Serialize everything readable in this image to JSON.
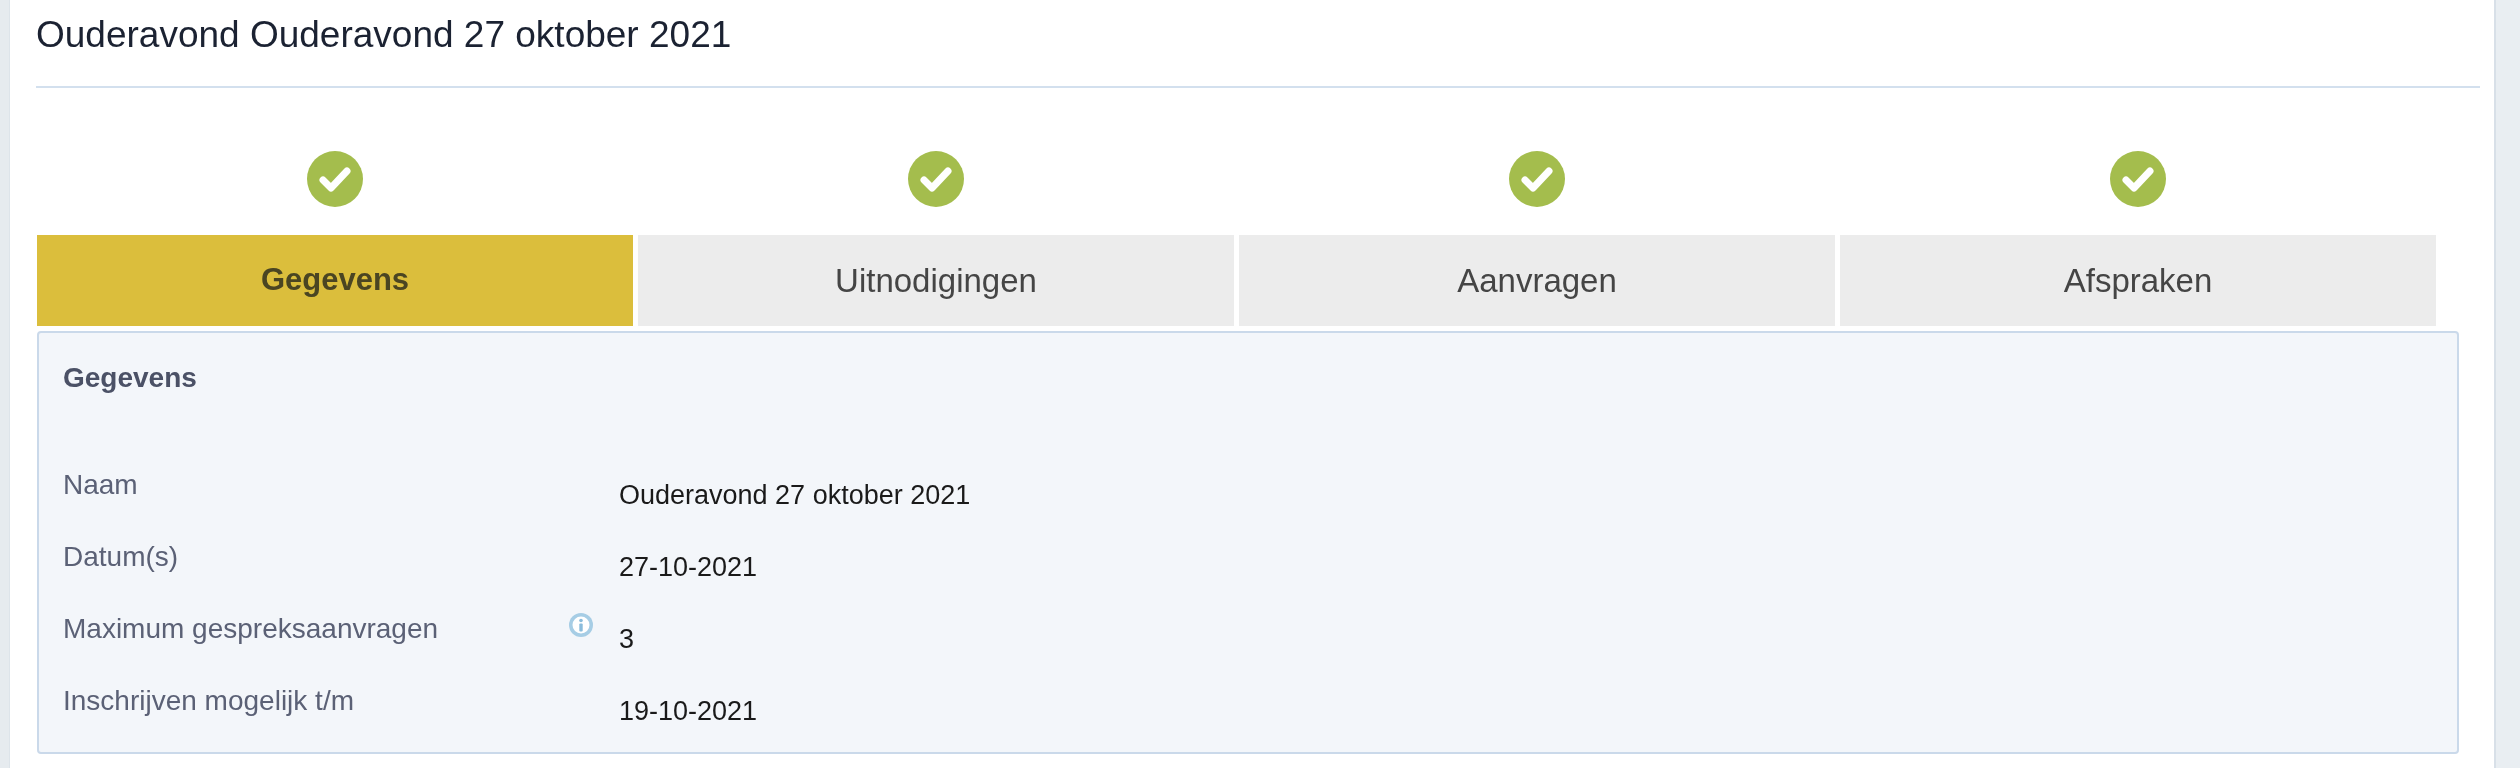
{
  "title": "Ouderavond Ouderavond 27 oktober 2021",
  "steps": [
    {
      "label": "Gegevens",
      "selected": true,
      "done": true
    },
    {
      "label": "Uitnodigingen",
      "selected": false,
      "done": true
    },
    {
      "label": "Aanvragen",
      "selected": false,
      "done": true
    },
    {
      "label": "Afspraken",
      "selected": false,
      "done": true
    }
  ],
  "panel": {
    "heading": "Gegevens",
    "fields": [
      {
        "label": "Naam",
        "value": "Ouderavond 27 oktober 2021",
        "info": false
      },
      {
        "label": "Datum(s)",
        "value": "27-10-2021",
        "info": false
      },
      {
        "label": "Maximum gespreksaanvragen",
        "value": "3",
        "info": true
      },
      {
        "label": "Inschrijven mogelijk t/m",
        "value": "19-10-2021",
        "info": false
      }
    ]
  }
}
